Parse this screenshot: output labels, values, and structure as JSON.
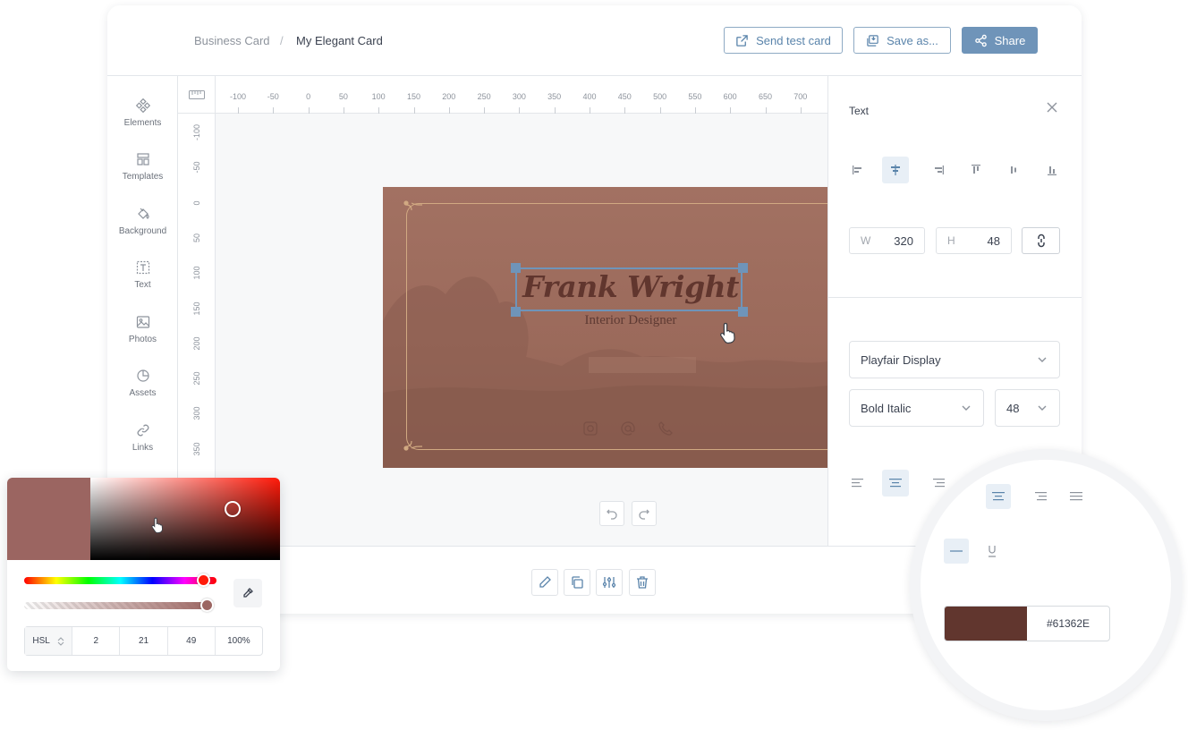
{
  "breadcrumb": {
    "root": "Business Card",
    "separator": "/",
    "current": "My Elegant Card"
  },
  "header": {
    "send_label": "Send test card",
    "save_label": "Save as...",
    "share_label": "Share"
  },
  "sidebar": {
    "items": [
      {
        "label": "Elements",
        "icon": "elements-icon"
      },
      {
        "label": "Templates",
        "icon": "templates-icon"
      },
      {
        "label": "Background",
        "icon": "paint-bucket-icon"
      },
      {
        "label": "Text",
        "icon": "text-icon"
      },
      {
        "label": "Photos",
        "icon": "image-icon"
      },
      {
        "label": "Assets",
        "icon": "assets-icon"
      },
      {
        "label": "Links",
        "icon": "link-icon"
      }
    ]
  },
  "ruler": {
    "h_labels": [
      "-100",
      "-50",
      "0",
      "50",
      "100",
      "150",
      "200",
      "250",
      "300",
      "350",
      "400",
      "450",
      "500",
      "550",
      "600",
      "650",
      "700"
    ],
    "v_labels": [
      "-100",
      "-50",
      "0",
      "50",
      "100",
      "150",
      "200",
      "250",
      "300",
      "350"
    ]
  },
  "card": {
    "name": "Frank Wright",
    "role": "Interior Designer"
  },
  "panel": {
    "title": "Text",
    "width_label": "W",
    "width_value": "320",
    "height_label": "H",
    "height_value": "48",
    "font_family": "Playfair Display",
    "font_style": "Bold Italic",
    "font_size": "48"
  },
  "color_picker": {
    "mode": "HSL",
    "h": "2",
    "s": "21",
    "l": "49",
    "alpha": "100%",
    "preview_color": "#9b6561"
  },
  "magnifier": {
    "hex": "#61362E"
  },
  "colors": {
    "accent": "#6f94b9",
    "card_bg": "#9f6e5f",
    "text_color": "#61362e"
  }
}
